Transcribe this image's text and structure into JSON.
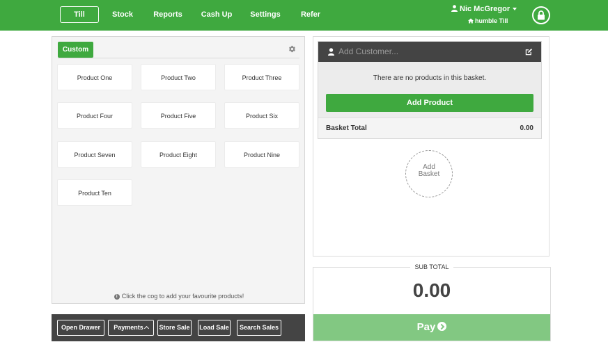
{
  "nav": {
    "items": [
      {
        "label": "Till",
        "active": true
      },
      {
        "label": "Stock"
      },
      {
        "label": "Reports"
      },
      {
        "label": "Cash Up"
      },
      {
        "label": "Settings"
      },
      {
        "label": "Refer"
      }
    ],
    "user": {
      "name": "Nic McGregor",
      "store": "humble Till"
    },
    "lock_icon": "lock-icon",
    "brand_color": "#3fa93f"
  },
  "products": {
    "tab_label": "Custom",
    "settings_icon": "cog-icon",
    "items": [
      "Product One",
      "Product Two",
      "Product Three",
      "Product Four",
      "Product Five",
      "Product Six",
      "Product Seven",
      "Product Eight",
      "Product Nine",
      "Product Ten"
    ],
    "hint": "Click the cog to add your favourite products!"
  },
  "actions": {
    "open_drawer": "Open Drawer",
    "payments": "Payments",
    "store_sale": "Store Sale",
    "load_sale": "Load Sale",
    "search_sales": "Search Sales"
  },
  "basket": {
    "customer_placeholder": "Add Customer...",
    "empty_message": "There are no products in this basket.",
    "add_product": "Add Product",
    "total_label": "Basket Total",
    "total_value": "0.00",
    "add_basket": "Add Basket"
  },
  "summary": {
    "subtotal_label": "SUB TOTAL",
    "subtotal_value": "0.00",
    "pay_label": "Pay"
  }
}
